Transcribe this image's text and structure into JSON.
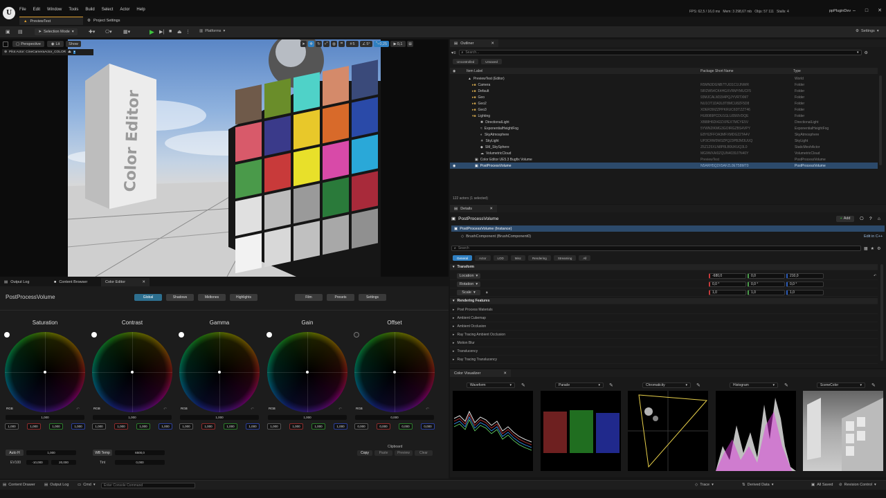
{
  "app": {
    "menu": [
      "File",
      "Edit",
      "Window",
      "Tools",
      "Build",
      "Select",
      "Actor",
      "Help"
    ],
    "stats": "FPS: 62,5 / 16,0 ms   Mem: 3 298,67 mb   Objs: 57 111   Stalls: 4",
    "project": "ppPluginDev"
  },
  "tabs": {
    "level": "PreviewTest",
    "project_settings": "Project Settings"
  },
  "toolbar": {
    "mode": "Selection Mode",
    "platforms": "Platforms",
    "settings": "Settings"
  },
  "viewport": {
    "perspective": "Perspective",
    "lit": "Lit",
    "show": "Show",
    "pilot": "Pilot Actor: CineCameraActor_COLOR",
    "grid": "5",
    "angle": "5°",
    "scale": "0,25",
    "speed": "0,1",
    "box_text": "Color Editor"
  },
  "outliner": {
    "tab": "Outliner",
    "search_placeholder": "Search...",
    "filter_uncontrolled": "Uncontrolled",
    "filter_unsaved": "Unsaved",
    "col_label": "Item Label",
    "col_pkg": "Package Short Name",
    "col_type": "Type",
    "rows": [
      {
        "label": "PreviewTest (Editor)",
        "pkg": "",
        "type": "World"
      },
      {
        "label": "Camera",
        "pkg": "R5MN3DGNB7TUI31C1IJNWR",
        "type": "Folder"
      },
      {
        "label": "Default",
        "pkg": "5IR2W54CK4HGXVRMYMUCF5",
        "type": "Folder"
      },
      {
        "label": "Geo",
        "pkg": "93MJCALM33I4PQJYVRTXM7",
        "type": "Folder"
      },
      {
        "label": "Geo2",
        "pkg": "NU1OT1DA3L8T8MCU8ZF5D8",
        "type": "Folder"
      },
      {
        "label": "Geo3",
        "pkg": "XDER39IZZPPKRUC6DTZZT46",
        "type": "Folder"
      },
      {
        "label": "Lighting",
        "pkg": "HU8089PCDU1GLU056IVDQE",
        "type": "Folder"
      },
      {
        "label": "DirectionalLight",
        "pkg": "XB88H6DI42ZXPEXTMCYE5V",
        "type": "DirectionalLight"
      },
      {
        "label": "ExponentialHeightFog",
        "pkg": "5YWN2IKMG3GOIRGZBS4VPY",
        "type": "ExponentialHeightFog"
      },
      {
        "label": "SkyAtmosphere",
        "pkg": "E8Y62FFOA3MFXMDG22TA4V",
        "type": "SkyAtmosphere"
      },
      {
        "label": "SkyLight",
        "pkg": "UP3CRW0W3ZPQ23PB2M3UUQ",
        "type": "SkyLight"
      },
      {
        "label": "SM_SkySphere",
        "pkg": "Z6Z125XLN8P8LB9UKUQ3L0",
        "type": "StaticMeshActor"
      },
      {
        "label": "VolumetricCloud",
        "pkg": "MG9WXAI0ZQUN4039J7N40Y",
        "type": "VolumetricCloud"
      },
      {
        "label": "Color Editor UE5.3 Bugfix Volume",
        "pkg": "PreviewTest",
        "type": "PostProcessVolume"
      },
      {
        "label": "PostProcessVolume",
        "pkg": "N5ARH5Q2X5AFZL0ET58MT0",
        "type": "PostProcessVolume"
      }
    ],
    "count": "122 actors (1 selected)"
  },
  "details": {
    "tab": "Details",
    "actor": "PostProcessVolume",
    "add": "Add",
    "instance": "PostProcessVolume (Instance)",
    "brush": "BrushComponent (BrushComponent0)",
    "edit_cpp": "Edit in C++",
    "search_placeholder": "Search",
    "filters": [
      "General",
      "Actor",
      "LOD",
      "Misc",
      "Rendering",
      "Streaming",
      "All"
    ],
    "transform_hdr": "Transform",
    "location": {
      "label": "Location",
      "x": "-680,0",
      "y": "0,0",
      "z": "210,0"
    },
    "rotation": {
      "label": "Rotation",
      "x": "0,0 °",
      "y": "0,0 °",
      "z": "0,0 °"
    },
    "scale": {
      "label": "Scale",
      "x": "1,0",
      "y": "1,0",
      "z": "1,0"
    },
    "rendering_hdr": "Rendering Features",
    "features": [
      "Post Process Materials",
      "Ambient Cubemap",
      "Ambient Occlusion",
      "Ray Tracing Ambient Occlusion",
      "Motion Blur",
      "Translucency",
      "Ray Tracing Translucency"
    ]
  },
  "bottom": {
    "tabs": [
      "Output Log",
      "Content Browser",
      "Color Editor"
    ],
    "target": "PostProcessVolume",
    "groups": [
      "Global",
      "Shadows",
      "Midtones",
      "Highlights"
    ],
    "right_buttons": [
      "Film",
      "Presets",
      "Settings"
    ],
    "wheels": [
      {
        "name": "Saturation",
        "master": "1,000",
        "v": [
          "1,000",
          "1,000",
          "1,000",
          "1,000"
        ]
      },
      {
        "name": "Contrast",
        "master": "1,000",
        "v": [
          "1,000",
          "1,000",
          "1,000",
          "1,000"
        ]
      },
      {
        "name": "Gamma",
        "master": "1,000",
        "v": [
          "1,000",
          "1,000",
          "1,000",
          "1,000"
        ]
      },
      {
        "name": "Gain",
        "master": "1,000",
        "v": [
          "1,000",
          "1,000",
          "1,000",
          "1,000"
        ]
      },
      {
        "name": "Offset",
        "master": "0,000",
        "v": [
          "0,000",
          "0,000",
          "0,000",
          "0,000"
        ]
      }
    ],
    "rgb": "RGB",
    "auto_h": "Auto H",
    "auto_h_val": "1,000",
    "ev100": "EV100",
    "ev_min": "-10,000",
    "ev_max": "20,000",
    "wb_temp": "WB Temp",
    "wb_val": "6500,0",
    "tint": "Tint",
    "tint_val": "0,000",
    "clipboard": "Clipboard",
    "clip_buttons": [
      "Copy",
      "Paste",
      "Preview",
      "Clear"
    ]
  },
  "visualizer": {
    "tab": "Color Visualizer",
    "scopes": [
      "Waveform",
      "Parade",
      "Chromaticity",
      "Histogram",
      "SceneColor"
    ]
  },
  "status": {
    "content_drawer": "Content Drawer",
    "output_log": "Output Log",
    "cmd": "Cmd",
    "console_placeholder": "Enter Console Command",
    "trace": "Trace",
    "derived": "Derived Data",
    "saved": "All Saved",
    "revision": "Revision Control"
  },
  "colors": {
    "accent": "#2f7fc1",
    "selected_row": "#2c4a6b",
    "play": "#3ec23e"
  }
}
